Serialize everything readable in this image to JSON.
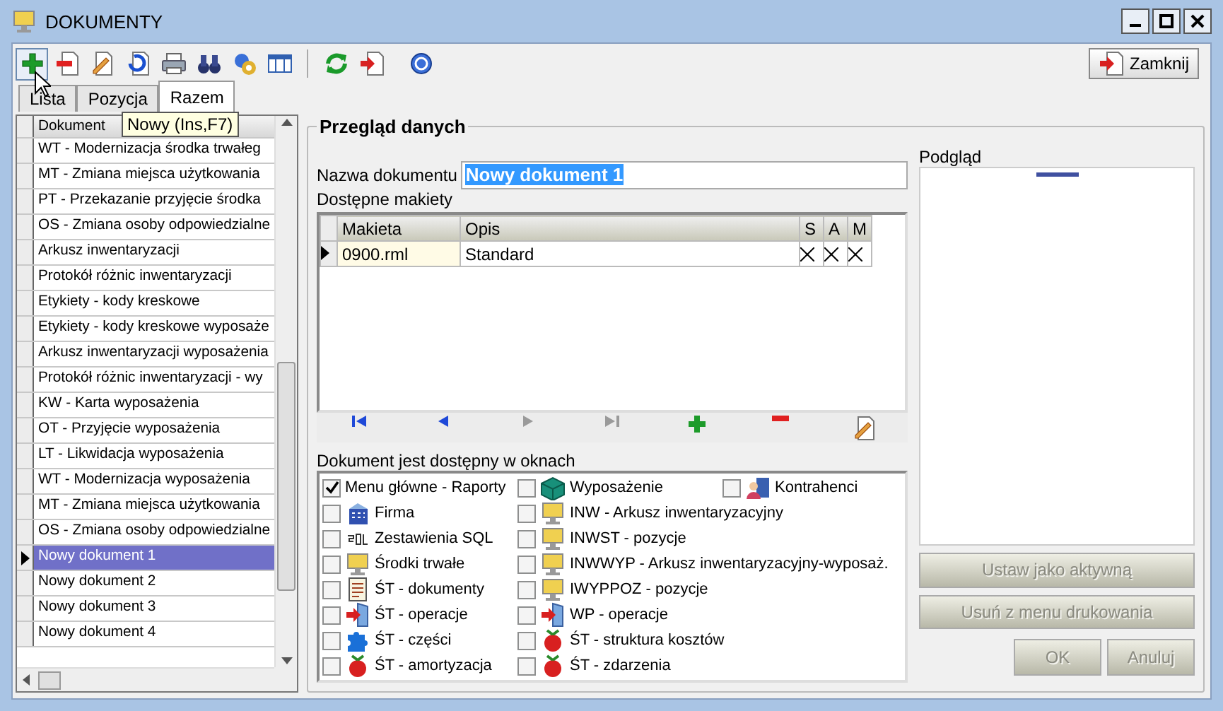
{
  "window": {
    "title": "DOKUMENTY"
  },
  "toolbar": {
    "close_button": "Zamknij",
    "tooltip": "Nowy (Ins,F7)"
  },
  "tabs": [
    {
      "label": "Lista",
      "selected": false
    },
    {
      "label": "Pozycja",
      "selected": false
    },
    {
      "label": "Razem",
      "selected": true
    }
  ],
  "document_list": {
    "column": "Dokument",
    "rows": [
      {
        "name": "WT - Modernizacja środka trwałeg",
        "selected": false
      },
      {
        "name": "MT - Zmiana miejsca użytkowania",
        "selected": false
      },
      {
        "name": "PT - Przekazanie przyjęcie środka",
        "selected": false
      },
      {
        "name": "OS - Zmiana osoby odpowiedzialne",
        "selected": false
      },
      {
        "name": "Arkusz inwentaryzacji",
        "selected": false
      },
      {
        "name": "Protokół różnic inwentaryzacji",
        "selected": false
      },
      {
        "name": "Etykiety - kody kreskowe",
        "selected": false
      },
      {
        "name": "Etykiety - kody kreskowe wyposaże",
        "selected": false
      },
      {
        "name": "Arkusz inwentaryzacji wyposażenia",
        "selected": false
      },
      {
        "name": "Protokół różnic inwentaryzacji - wy",
        "selected": false
      },
      {
        "name": "KW - Karta wyposażenia",
        "selected": false
      },
      {
        "name": "OT - Przyjęcie wyposażenia",
        "selected": false
      },
      {
        "name": "LT - Likwidacja wyposażenia",
        "selected": false
      },
      {
        "name": "WT - Modernizacja wyposażenia",
        "selected": false
      },
      {
        "name": "MT - Zmiana miejsca użytkowania",
        "selected": false
      },
      {
        "name": "OS - Zmiana osoby odpowiedzialne",
        "selected": false
      },
      {
        "name": "Nowy dokument 1",
        "selected": true
      },
      {
        "name": "Nowy dokument 2",
        "selected": false
      },
      {
        "name": "Nowy dokument 3",
        "selected": false
      },
      {
        "name": "Nowy dokument 4",
        "selected": false
      }
    ]
  },
  "panel": {
    "title": "Przegląd danych",
    "name_label": "Nazwa dokumentu",
    "name_value": "Nowy dokument 1",
    "layouts_label": "Dostępne makiety",
    "layouts": {
      "columns": [
        "Makieta",
        "Opis",
        "S",
        "A",
        "M"
      ],
      "rows": [
        {
          "makieta": "0900.rml",
          "opis": "Standard",
          "s": true,
          "a": true,
          "m": true
        }
      ]
    },
    "navigator": [
      {
        "kind": "first",
        "disabled": false
      },
      {
        "kind": "prior",
        "disabled": false
      },
      {
        "kind": "next",
        "disabled": true
      },
      {
        "kind": "last",
        "disabled": true
      },
      {
        "kind": "insert",
        "disabled": false
      },
      {
        "kind": "delete",
        "disabled": false
      },
      {
        "kind": "edit",
        "disabled": false
      }
    ],
    "windows_label": "Dokument jest dostępny w oknach",
    "windows": [
      [
        {
          "label": "Menu główne - Raporty",
          "checked": true
        },
        {
          "label": "Firma",
          "checked": false
        },
        {
          "label": "Zestawienia SQL",
          "checked": false
        },
        {
          "label": "Środki trwałe",
          "checked": false
        },
        {
          "label": "ŚT - dokumenty",
          "checked": false
        },
        {
          "label": "ŚT - operacje",
          "checked": false
        },
        {
          "label": "ŚT - części",
          "checked": false
        },
        {
          "label": "ŚT - amortyzacja",
          "checked": false
        }
      ],
      [
        {
          "label": "Wyposażenie",
          "checked": false
        },
        {
          "label": "INW - Arkusz inwentaryzacyjny",
          "checked": false
        },
        {
          "label": "INWST - pozycje",
          "checked": false
        },
        {
          "label": "INWWYP - Arkusz inwentaryzacyjny-wyposaż.",
          "checked": false
        },
        {
          "label": "IWYPPOZ - pozycje",
          "checked": false
        },
        {
          "label": "WP - operacje",
          "checked": false
        },
        {
          "label": "ŚT - struktura kosztów",
          "checked": false
        },
        {
          "label": "ŚT - zdarzenia",
          "checked": false
        }
      ],
      [
        {
          "label": "Kontrahenci",
          "checked": false
        }
      ]
    ],
    "preview_label": "Podgląd",
    "buttons": [
      {
        "label": "Ustaw jako aktywną",
        "disabled": true
      },
      {
        "label": "Usuń z menu drukowania",
        "disabled": true
      }
    ],
    "ok": {
      "label": "OK",
      "disabled": true
    },
    "cancel": {
      "label": "Anuluj",
      "disabled": true
    }
  }
}
